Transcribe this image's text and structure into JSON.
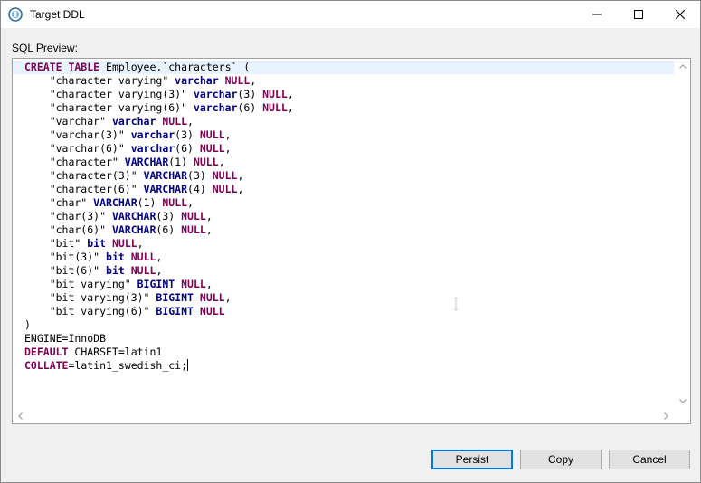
{
  "window": {
    "title": "Target DDL"
  },
  "dialog": {
    "preview_label": "SQL Preview:"
  },
  "sql": {
    "lines": [
      [
        {
          "k": "kw1",
          "t": "CREATE TABLE"
        },
        {
          "t": " Employee.`characters` ("
        }
      ],
      [
        {
          "t": "    \"character varying\" "
        },
        {
          "k": "kw2",
          "t": "varchar"
        },
        {
          "t": " "
        },
        {
          "k": "kw1",
          "t": "NULL"
        },
        {
          "t": ","
        }
      ],
      [
        {
          "t": "    \"character varying(3)\" "
        },
        {
          "k": "kw2",
          "t": "varchar"
        },
        {
          "t": "(3) "
        },
        {
          "k": "kw1",
          "t": "NULL"
        },
        {
          "t": ","
        }
      ],
      [
        {
          "t": "    \"character varying(6)\" "
        },
        {
          "k": "kw2",
          "t": "varchar"
        },
        {
          "t": "(6) "
        },
        {
          "k": "kw1",
          "t": "NULL"
        },
        {
          "t": ","
        }
      ],
      [
        {
          "t": "    \"varchar\" "
        },
        {
          "k": "kw2",
          "t": "varchar"
        },
        {
          "t": " "
        },
        {
          "k": "kw1",
          "t": "NULL"
        },
        {
          "t": ","
        }
      ],
      [
        {
          "t": "    \"varchar(3)\" "
        },
        {
          "k": "kw2",
          "t": "varchar"
        },
        {
          "t": "(3) "
        },
        {
          "k": "kw1",
          "t": "NULL"
        },
        {
          "t": ","
        }
      ],
      [
        {
          "t": "    \"varchar(6)\" "
        },
        {
          "k": "kw2",
          "t": "varchar"
        },
        {
          "t": "(6) "
        },
        {
          "k": "kw1",
          "t": "NULL"
        },
        {
          "t": ","
        }
      ],
      [
        {
          "t": "    \"character\" "
        },
        {
          "k": "kw2",
          "t": "VARCHAR"
        },
        {
          "t": "(1) "
        },
        {
          "k": "kw1",
          "t": "NULL"
        },
        {
          "t": ","
        }
      ],
      [
        {
          "t": "    \"character(3)\" "
        },
        {
          "k": "kw2",
          "t": "VARCHAR"
        },
        {
          "t": "(3) "
        },
        {
          "k": "kw1",
          "t": "NULL"
        },
        {
          "t": ","
        }
      ],
      [
        {
          "t": "    \"character(6)\" "
        },
        {
          "k": "kw2",
          "t": "VARCHAR"
        },
        {
          "t": "(4) "
        },
        {
          "k": "kw1",
          "t": "NULL"
        },
        {
          "t": ","
        }
      ],
      [
        {
          "t": "    \"char\" "
        },
        {
          "k": "kw2",
          "t": "VARCHAR"
        },
        {
          "t": "(1) "
        },
        {
          "k": "kw1",
          "t": "NULL"
        },
        {
          "t": ","
        }
      ],
      [
        {
          "t": "    \"char(3)\" "
        },
        {
          "k": "kw2",
          "t": "VARCHAR"
        },
        {
          "t": "(3) "
        },
        {
          "k": "kw1",
          "t": "NULL"
        },
        {
          "t": ","
        }
      ],
      [
        {
          "t": "    \"char(6)\" "
        },
        {
          "k": "kw2",
          "t": "VARCHAR"
        },
        {
          "t": "(6) "
        },
        {
          "k": "kw1",
          "t": "NULL"
        },
        {
          "t": ","
        }
      ],
      [
        {
          "t": "    \"bit\" "
        },
        {
          "k": "kw2",
          "t": "bit"
        },
        {
          "t": " "
        },
        {
          "k": "kw1",
          "t": "NULL"
        },
        {
          "t": ","
        }
      ],
      [
        {
          "t": "    \"bit(3)\" "
        },
        {
          "k": "kw2",
          "t": "bit"
        },
        {
          "t": " "
        },
        {
          "k": "kw1",
          "t": "NULL"
        },
        {
          "t": ","
        }
      ],
      [
        {
          "t": "    \"bit(6)\" "
        },
        {
          "k": "kw2",
          "t": "bit"
        },
        {
          "t": " "
        },
        {
          "k": "kw1",
          "t": "NULL"
        },
        {
          "t": ","
        }
      ],
      [
        {
          "t": "    \"bit varying\" "
        },
        {
          "k": "kw2",
          "t": "BIGINT"
        },
        {
          "t": " "
        },
        {
          "k": "kw1",
          "t": "NULL"
        },
        {
          "t": ","
        }
      ],
      [
        {
          "t": "    \"bit varying(3)\" "
        },
        {
          "k": "kw2",
          "t": "BIGINT"
        },
        {
          "t": " "
        },
        {
          "k": "kw1",
          "t": "NULL"
        },
        {
          "t": ","
        }
      ],
      [
        {
          "t": "    \"bit varying(6)\" "
        },
        {
          "k": "kw2",
          "t": "BIGINT"
        },
        {
          "t": " "
        },
        {
          "k": "kw1",
          "t": "NULL"
        }
      ],
      [
        {
          "t": ")"
        }
      ],
      [
        {
          "t": "ENGINE=InnoDB"
        }
      ],
      [
        {
          "k": "kw1",
          "t": "DEFAULT"
        },
        {
          "t": " CHARSET=latin1"
        }
      ],
      [
        {
          "k": "kw1",
          "t": "COLLATE"
        },
        {
          "t": "=latin1_swedish_ci;"
        }
      ]
    ]
  },
  "buttons": {
    "persist": "Persist",
    "copy": "Copy",
    "cancel": "Cancel"
  },
  "icons": {
    "app": "app-logo-icon",
    "minimize": "minimize-icon",
    "maximize": "maximize-icon",
    "close": "close-icon"
  },
  "colors": {
    "keyword_primary": "#7f0055",
    "keyword_type": "#000080",
    "current_line": "#e8f2fe",
    "default_button_border": "#0078d7"
  }
}
